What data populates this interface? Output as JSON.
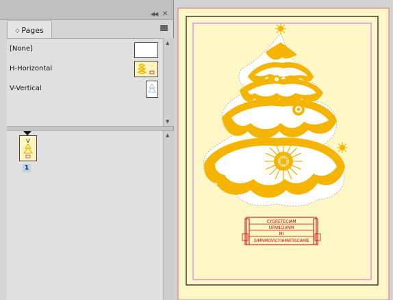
{
  "panel": {
    "tab_label": "Pages",
    "masters": [
      {
        "label": "[None]"
      },
      {
        "label": "H-Horizontal"
      },
      {
        "label": "V-Vertical"
      }
    ],
    "page_thumb_prefix": "V",
    "page_number": "1"
  },
  "document": {
    "page_color": "#fff7c6",
    "tree_color": "#f4b400",
    "tag_color": "#cc0000",
    "tag_lines": [
      "CYGRETECIAM",
      "UFNNCIVNM",
      "MI",
      "SIMNMOVICYIAMATISCAMB"
    ]
  }
}
